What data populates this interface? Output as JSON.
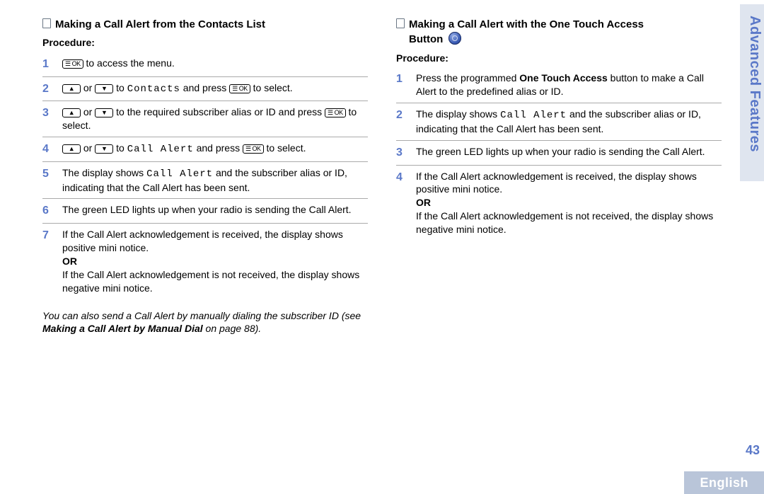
{
  "sideTab": "Advanced Features",
  "pageNumber": "43",
  "footerLang": "English",
  "left": {
    "title": "Making a Call Alert from the Contacts List",
    "procedure": "Procedure:",
    "keys": {
      "ok": "☰ OK",
      "up": "▲",
      "down": "▼"
    },
    "steps": {
      "n1": "1",
      "s1a": " to access the menu.",
      "n2": "2",
      "s2a": " or ",
      "s2b": " to ",
      "s2c": "Contacts",
      "s2d": " and press ",
      "s2e": " to select.",
      "n3": "3",
      "s3a": " or ",
      "s3b": " to the required subscriber alias or ID and press ",
      "s3c": " to select.",
      "n4": "4",
      "s4a": " or ",
      "s4b": " to ",
      "s4c": "Call Alert",
      "s4d": " and press ",
      "s4e": " to select.",
      "n5": "5",
      "s5": "The display shows ",
      "s5b": "Call Alert",
      "s5c": " and the subscriber alias or ID, indicating that the Call Alert has been sent.",
      "n6": "6",
      "s6": "The green LED lights up when your radio is sending the Call Alert.",
      "n7": "7",
      "s7a": "If the Call Alert acknowledgement is received, the display shows positive mini notice.",
      "or": "OR",
      "s7b": "If the Call Alert acknowledgement is not received, the display shows negative mini notice."
    },
    "footnote": {
      "a": "You can also send a Call Alert by manually dialing the subscriber ID (see ",
      "b": "Making a Call Alert by Manual Dial",
      "c": " on page 88)."
    }
  },
  "right": {
    "titleA": "Making a Call Alert with the One Touch Access",
    "titleB": "Button",
    "procedure": "Procedure:",
    "steps": {
      "n1": "1",
      "s1a": "Press the programmed ",
      "s1b": "One Touch Access",
      "s1c": " button to make a Call Alert to the predefined alias or ID.",
      "n2": "2",
      "s2a": "The display shows ",
      "s2b": "Call Alert",
      "s2c": " and the subscriber alias or ID, indicating that the Call Alert has been sent.",
      "n3": "3",
      "s3": "The green LED lights up when your radio is sending the Call Alert.",
      "n4": "4",
      "s4a": "If the Call Alert acknowledgement is received, the display shows positive mini notice.",
      "or": "OR",
      "s4b": "If the Call Alert acknowledgement is not received, the display shows negative mini notice."
    }
  }
}
